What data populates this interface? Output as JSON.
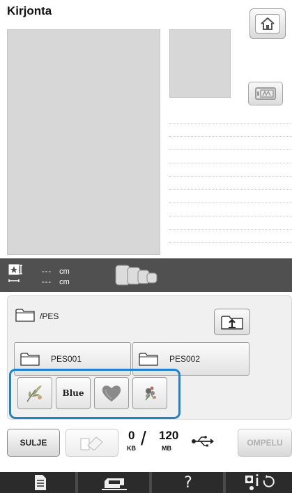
{
  "header": {
    "title": "Kirjonta"
  },
  "size_display": {
    "width_value": "---",
    "width_unit": "cm",
    "height_value": "---",
    "height_unit": "cm"
  },
  "folder_panel": {
    "current_path": "/PES",
    "folders": [
      {
        "label": "PES001"
      },
      {
        "label": "PES002"
      }
    ],
    "designs": [
      {
        "icon": "flower-sprig-design",
        "label": ""
      },
      {
        "icon": "text-design",
        "label": "Blue"
      },
      {
        "icon": "heart-design",
        "label": ""
      },
      {
        "icon": "floral-ornament-design",
        "label": ""
      }
    ]
  },
  "actions": {
    "close_label": "SULJE",
    "sew_label": "OMPELU"
  },
  "memory": {
    "used": "0",
    "used_unit": "KB",
    "total": "120",
    "total_unit": "MB"
  },
  "bottom_nav": {
    "help_label": "?"
  },
  "colors": {
    "highlight": "#1f83c9",
    "dark_bar": "#505050",
    "nav_bar": "#2b2b2b",
    "preview_gray": "#d7d7d7"
  }
}
